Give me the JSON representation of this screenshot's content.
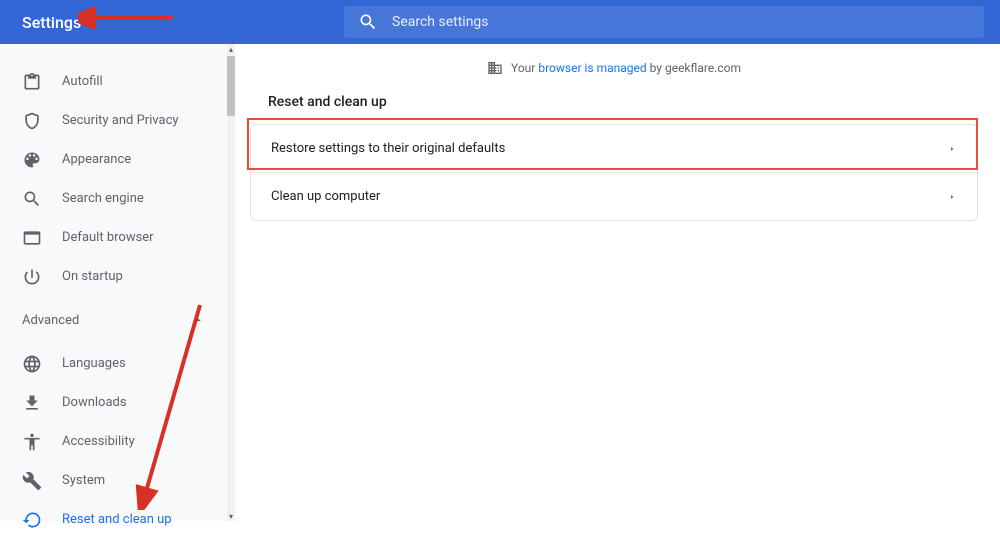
{
  "header": {
    "title": "Settings",
    "search_placeholder": "Search settings"
  },
  "sidebar": {
    "items": [
      {
        "label": "Autofill",
        "icon": "clipboard-icon",
        "active": false
      },
      {
        "label": "Security and Privacy",
        "icon": "shield-icon",
        "active": false
      },
      {
        "label": "Appearance",
        "icon": "palette-icon",
        "active": false
      },
      {
        "label": "Search engine",
        "icon": "search-icon",
        "active": false
      },
      {
        "label": "Default browser",
        "icon": "browser-icon",
        "active": false
      },
      {
        "label": "On startup",
        "icon": "power-icon",
        "active": false
      }
    ],
    "section_label": "Advanced",
    "advanced_items": [
      {
        "label": "Languages",
        "icon": "globe-icon",
        "active": false
      },
      {
        "label": "Downloads",
        "icon": "download-icon",
        "active": false
      },
      {
        "label": "Accessibility",
        "icon": "accessibility-icon",
        "active": false
      },
      {
        "label": "System",
        "icon": "wrench-icon",
        "active": false
      },
      {
        "label": "Reset and clean up",
        "icon": "restore-icon",
        "active": true
      }
    ]
  },
  "main": {
    "managed_prefix": "Your ",
    "managed_link": "browser is managed",
    "managed_suffix": " by geekflare.com",
    "section_title": "Reset and clean up",
    "rows": [
      "Restore settings to their original defaults",
      "Clean up computer"
    ]
  },
  "annotations": {
    "arrow_to_title": true,
    "arrow_to_reset": true,
    "highlight_restore_row": true
  }
}
